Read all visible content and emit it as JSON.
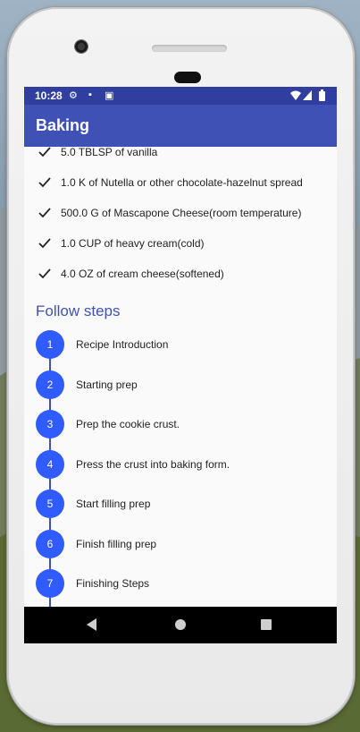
{
  "status_bar": {
    "time": "10:28",
    "icons": [
      "gear-icon",
      "sim-icon",
      "a-icon",
      "wifi-icon",
      "signal-icon",
      "battery-icon"
    ]
  },
  "app_bar": {
    "title": "Baking"
  },
  "ingredients": [
    "5.0 TBLSP of vanilla",
    "1.0 K of Nutella or other chocolate-hazelnut spread",
    "500.0 G of Mascapone Cheese(room temperature)",
    "1.0 CUP of heavy cream(cold)",
    "4.0 OZ of cream cheese(softened)"
  ],
  "steps_section": {
    "title": "Follow steps",
    "steps": [
      {
        "number": "1",
        "label": "Recipe Introduction"
      },
      {
        "number": "2",
        "label": "Starting prep"
      },
      {
        "number": "3",
        "label": "Prep the cookie crust."
      },
      {
        "number": "4",
        "label": "Press the crust into baking form."
      },
      {
        "number": "5",
        "label": "Start filling prep"
      },
      {
        "number": "6",
        "label": "Finish filling prep"
      },
      {
        "number": "7",
        "label": "Finishing Steps"
      }
    ]
  },
  "colors": {
    "primary": "#3f51b5",
    "primary_dark": "#303f9f",
    "step_circle": "#2f5bff",
    "screen_bg": "#fafafa"
  }
}
